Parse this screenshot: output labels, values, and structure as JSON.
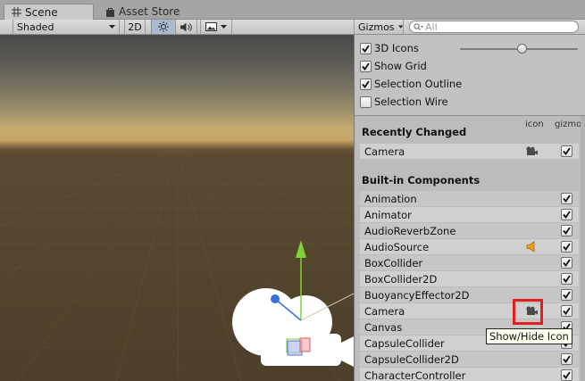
{
  "tabs": [
    {
      "label": "Scene",
      "icon": "grid-icon",
      "active": true
    },
    {
      "label": "Asset Store",
      "icon": "bag-icon",
      "active": false
    }
  ],
  "toolbar": {
    "shading_mode": "Shaded",
    "mode_2d_label": "2D",
    "gizmos_label": "Gizmos",
    "search_placeholder": "All"
  },
  "gizmo_options": [
    {
      "label": "3D Icons",
      "checked": true
    },
    {
      "label": "Show Grid",
      "checked": true
    },
    {
      "label": "Selection Outline",
      "checked": true
    },
    {
      "label": "Selection Wire",
      "checked": false
    }
  ],
  "columns": {
    "icon": "icon",
    "gizmo": "gizmo"
  },
  "recently_changed": {
    "title": "Recently Changed",
    "items": [
      {
        "label": "Camera",
        "icon": "camera-icon",
        "checked": true
      }
    ]
  },
  "builtin": {
    "title": "Built-in Components",
    "items": [
      {
        "label": "Animation",
        "icon": "",
        "checked": true
      },
      {
        "label": "Animator",
        "icon": "",
        "checked": true
      },
      {
        "label": "AudioReverbZone",
        "icon": "",
        "checked": true
      },
      {
        "label": "AudioSource",
        "icon": "speaker-icon",
        "checked": true
      },
      {
        "label": "BoxCollider",
        "icon": "",
        "checked": true
      },
      {
        "label": "BoxCollider2D",
        "icon": "",
        "checked": true
      },
      {
        "label": "BuoyancyEffector2D",
        "icon": "",
        "checked": true
      },
      {
        "label": "Camera",
        "icon": "camera-icon",
        "checked": true
      },
      {
        "label": "Canvas",
        "icon": "",
        "checked": true
      },
      {
        "label": "CapsuleCollider",
        "icon": "",
        "checked": true
      },
      {
        "label": "CapsuleCollider2D",
        "icon": "",
        "checked": true
      },
      {
        "label": "CharacterController",
        "icon": "",
        "checked": true
      }
    ]
  },
  "tooltip": "Show/Hide Icon",
  "colors": {
    "highlight": "#e02020",
    "gizmo_y_axis": "#7fd23a",
    "gizmo_z_axis": "#3a6fe0"
  }
}
